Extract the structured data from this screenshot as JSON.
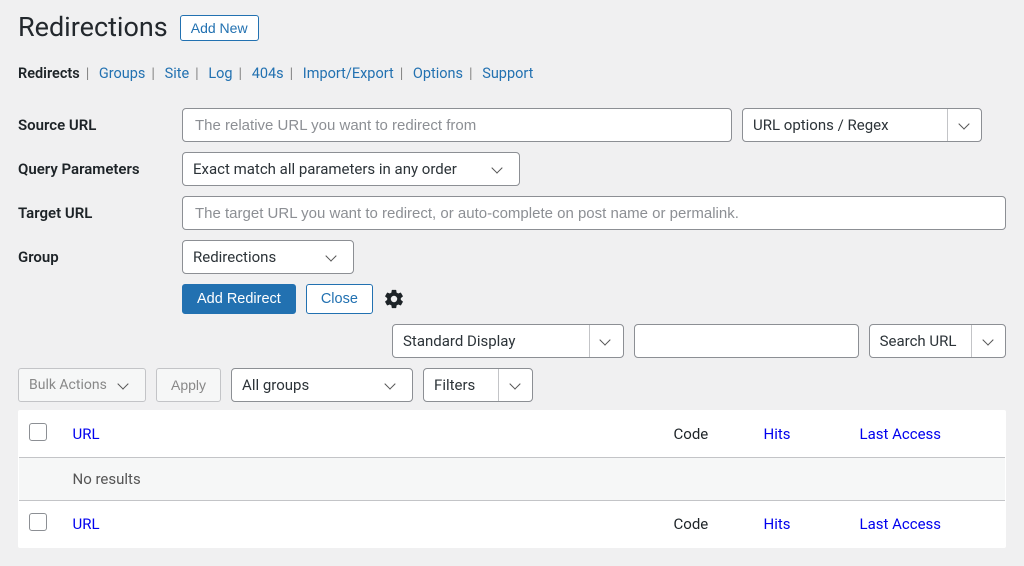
{
  "header": {
    "title": "Redirections",
    "add_new": "Add New"
  },
  "subnav": {
    "items": [
      {
        "label": "Redirects",
        "current": true
      },
      {
        "label": "Groups",
        "current": false
      },
      {
        "label": "Site",
        "current": false
      },
      {
        "label": "Log",
        "current": false
      },
      {
        "label": "404s",
        "current": false
      },
      {
        "label": "Import/Export",
        "current": false
      },
      {
        "label": "Options",
        "current": false
      },
      {
        "label": "Support",
        "current": false
      }
    ]
  },
  "form": {
    "source_label": "Source URL",
    "source_placeholder": "The relative URL you want to redirect from",
    "urlopts_label": "URL options / Regex",
    "query_label": "Query Parameters",
    "query_value": "Exact match all parameters in any order",
    "target_label": "Target URL",
    "target_placeholder": "The target URL you want to redirect, or auto-complete on post name or permalink.",
    "group_label": "Group",
    "group_value": "Redirections",
    "add_redirect": "Add Redirect",
    "close": "Close"
  },
  "display_bar": {
    "display_mode": "Standard Display",
    "search_value": "",
    "search_mode": "Search URL"
  },
  "bulk_bar": {
    "bulk_actions": "Bulk Actions",
    "apply": "Apply",
    "group_filter": "All groups",
    "filters": "Filters"
  },
  "table": {
    "columns": {
      "url": "URL",
      "code": "Code",
      "hits": "Hits",
      "last": "Last Access"
    },
    "empty": "No results"
  }
}
